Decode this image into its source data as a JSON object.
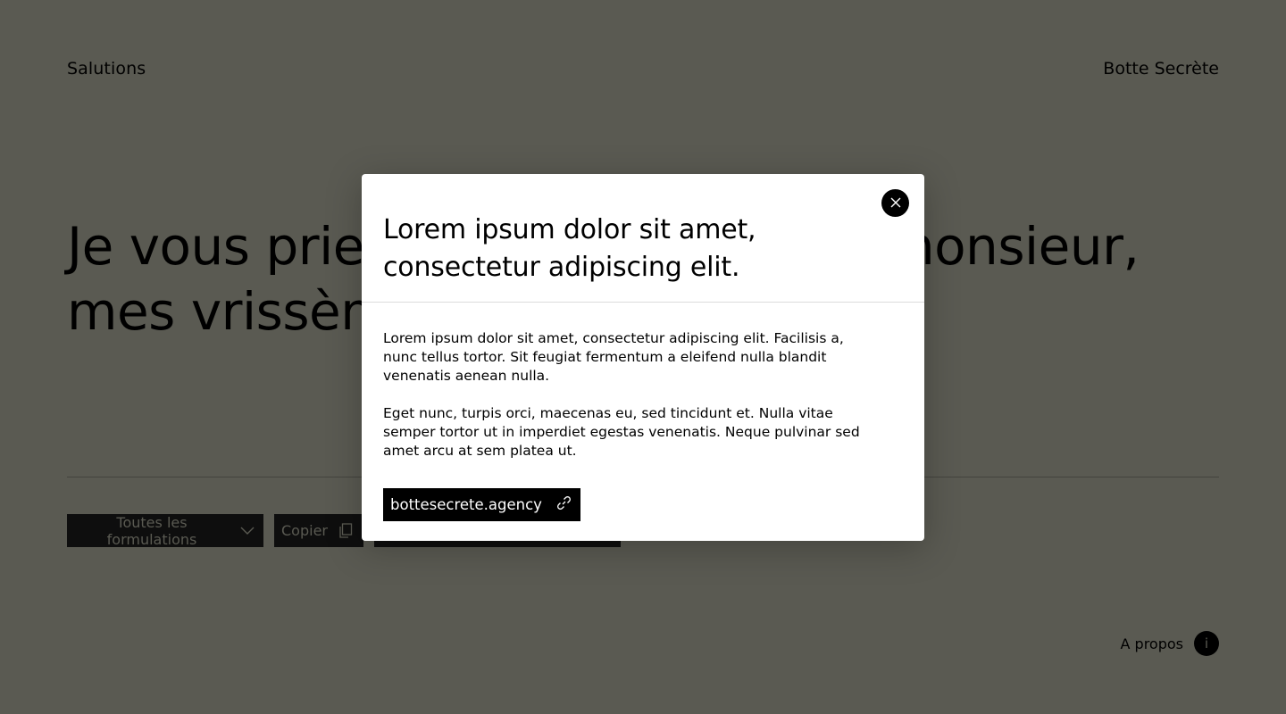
{
  "header": {
    "brand_left": "Salutions",
    "brand_right": "Botte Secrète"
  },
  "main": {
    "headline": "Je vous prie d'agréer, madame, monsieur, mes vrissèmes très"
  },
  "toolbar": {
    "select_label": "Toutes les formulations",
    "copy_label": "Copier",
    "third_label": ""
  },
  "footer": {
    "about_label": "A propos",
    "about_icon_text": "i"
  },
  "modal": {
    "title": "Lorem ipsum dolor sit amet, consectetur adipiscing elit.",
    "paragraphs": [
      "Lorem ipsum dolor sit amet, consectetur adipiscing elit. Facilisis a, nunc tellus tortor. Sit feugiat fermentum a eleifend nulla blandit venenatis aenean nulla.",
      "Eget nunc, turpis orci, maecenas eu, sed tincidunt et. Nulla vitae semper tortor ut in imperdiet egestas venenatis. Neque pulvinar sed amet arcu at sem platea ut."
    ],
    "link_label": "bottesecrete.agency",
    "icons": {
      "close": "close-icon",
      "link": "link-icon"
    }
  },
  "colors": {
    "background": "#5a5a52",
    "modal_bg": "#ffffff",
    "button_bg": "#000000"
  }
}
